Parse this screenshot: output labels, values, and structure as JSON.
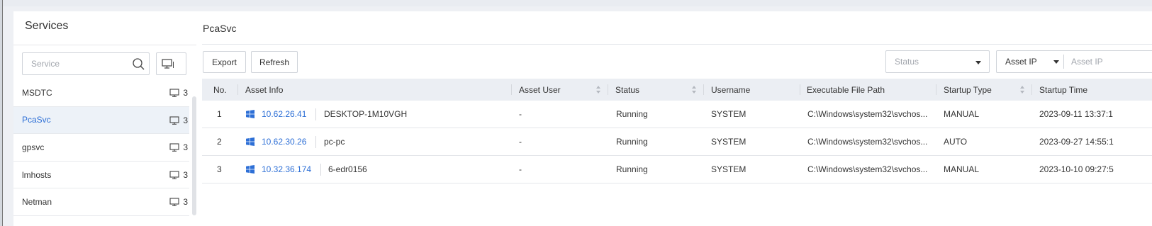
{
  "left_panel": {
    "title": "Services",
    "search": {
      "placeholder": "Service",
      "value": ""
    },
    "services": [
      {
        "name": "MSDTC",
        "count": "3"
      },
      {
        "name": "PcaSvc",
        "count": "3",
        "active": true
      },
      {
        "name": "gpsvc",
        "count": "3"
      },
      {
        "name": "lmhosts",
        "count": "3"
      },
      {
        "name": "Netman",
        "count": "3"
      }
    ]
  },
  "main_panel": {
    "title": "PcaSvc",
    "toolbar": {
      "export_label": "Export",
      "refresh_label": "Refresh",
      "status_placeholder": "Status",
      "asset_ip_select": "Asset IP",
      "asset_ip_placeholder": "Asset IP"
    },
    "table": {
      "columns": [
        "No.",
        "Asset Info",
        "Asset User",
        "Status",
        "Username",
        "Executable File Path",
        "Startup Type",
        "Startup Time"
      ],
      "rows": [
        {
          "no": "1",
          "ip": "10.62.26.41",
          "host": "DESKTOP-1M10VGH",
          "user": "-",
          "status": "Running",
          "username": "SYSTEM",
          "path": "C:\\Windows\\system32\\svchos...",
          "startup_type": "MANUAL",
          "startup_time": "2023-09-11 13:37:1"
        },
        {
          "no": "2",
          "ip": "10.62.30.26",
          "host": "pc-pc",
          "user": "-",
          "status": "Running",
          "username": "SYSTEM",
          "path": "C:\\Windows\\system32\\svchos...",
          "startup_type": "AUTO",
          "startup_time": "2023-09-27 14:55:1"
        },
        {
          "no": "3",
          "ip": "10.32.36.174",
          "host": "6-edr0156",
          "user": "-",
          "status": "Running",
          "username": "SYSTEM",
          "path": "C:\\Windows\\system32\\svchos...",
          "startup_type": "MANUAL",
          "startup_time": "2023-10-10 09:27:5"
        }
      ]
    }
  },
  "colors": {
    "accent": "#2d6fd6",
    "header_bg": "#ebeef3",
    "active_row_bg": "#edf2f8",
    "page_bg": "#eef0f4"
  },
  "icons": {
    "search": "search-icon",
    "device": "monitor-icon",
    "os": "windows-icon",
    "sort": "sort-icon",
    "dropdown": "chevron-down-icon"
  }
}
